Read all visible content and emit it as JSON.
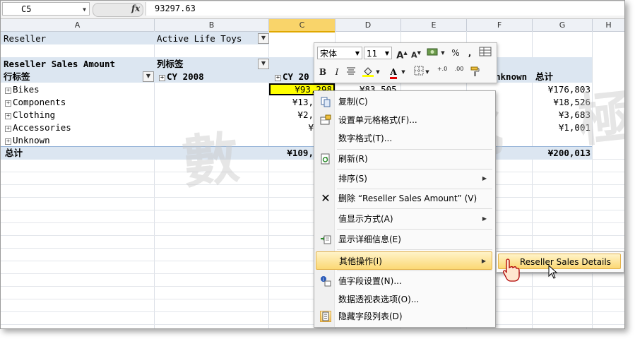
{
  "formula_bar": {
    "name_box": "C5",
    "fx": "fx",
    "value": "93297.63"
  },
  "columns": [
    "A",
    "B",
    "C",
    "D",
    "E",
    "F",
    "G",
    "H"
  ],
  "pivot": {
    "filter_field": "Reseller",
    "filter_value": "Active Life Toys",
    "measure_label": "Reseller Sales Amount",
    "col_labels_caption": "列标签",
    "row_labels_caption": "行标签",
    "cy2008": "CY 2008",
    "cy20_partial": "CY 20",
    "unknown_partial": "nknown",
    "total_header": "总计",
    "rows": [
      {
        "label": "Bikes",
        "c": "¥93,298",
        "d": "¥83,505",
        "g": "¥176,803"
      },
      {
        "label": "Components",
        "c": "¥13,",
        "d": "",
        "g": "¥18,526"
      },
      {
        "label": "Clothing",
        "c": "¥2,",
        "d": "",
        "g": "¥3,683"
      },
      {
        "label": "Accessories",
        "c": "¥",
        "d": "",
        "g": "¥1,001"
      },
      {
        "label": "Unknown",
        "c": "",
        "d": "",
        "g": ""
      }
    ],
    "grand_total_label": "总计",
    "grand_total_c": "¥109,",
    "grand_total_g": "¥200,013"
  },
  "mini_toolbar": {
    "font_name": "宋体",
    "font_size": "11",
    "grow": "A",
    "shrink": "A",
    "percent": "%",
    "comma": ",",
    "bold": "B",
    "italic": "I",
    "font_color_letter": "A",
    "inc_decimal": "+.0",
    "dec_decimal": ".00"
  },
  "context_menu": {
    "items": [
      {
        "label": "复制(C)",
        "icon": "copy-icon"
      },
      {
        "label": "设置单元格格式(F)...",
        "icon": "format-cells-icon"
      },
      {
        "label": "数字格式(T)...",
        "icon": ""
      },
      {
        "label": "刷新(R)",
        "icon": "refresh-icon"
      },
      {
        "label": "排序(S)",
        "icon": ""
      },
      {
        "label": "删除 “Reseller Sales Amount” (V)",
        "icon": "delete-icon"
      },
      {
        "label": "值显示方式(A)",
        "icon": ""
      },
      {
        "label": "显示详细信息(E)",
        "icon": "show-details-icon"
      },
      {
        "label": "其他操作(I)",
        "icon": ""
      },
      {
        "label": "值字段设置(N)...",
        "icon": "field-settings-icon"
      },
      {
        "label": "数据透视表选项(O)...",
        "icon": ""
      },
      {
        "label": "隐藏字段列表(D)",
        "icon": "field-list-icon"
      }
    ],
    "submenu_item": "Reseller Sales Details"
  },
  "watermark": "數 字 化 極",
  "colors": {
    "selected_cell": "#ffff00",
    "pivot_band": "#dce6f1",
    "menu_highlight": "#fbd874"
  }
}
